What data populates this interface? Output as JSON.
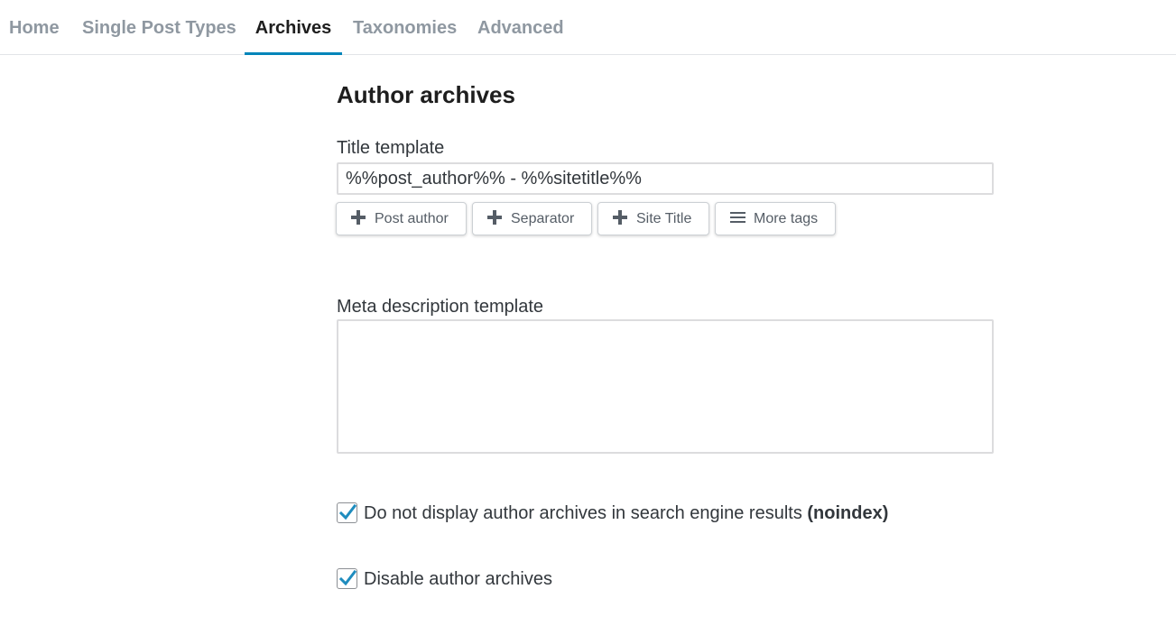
{
  "tabs": {
    "home": "Home",
    "single_post_types": "Single Post Types",
    "archives": "Archives",
    "taxonomies": "Taxonomies",
    "advanced": "Advanced",
    "active": "archives"
  },
  "section": {
    "title": "Author archives"
  },
  "title_template": {
    "label": "Title template",
    "value": "%%post_author%% - %%sitetitle%%"
  },
  "tag_buttons": {
    "post_author": "Post author",
    "separator": "Separator",
    "site_title": "Site Title",
    "more_tags": "More tags"
  },
  "meta_description": {
    "label": "Meta description template",
    "value": ""
  },
  "noindex": {
    "label": "Do not display author archives in search engine results",
    "label_bold": "(noindex)",
    "checked": true
  },
  "disable_archives": {
    "label": "Disable author archives",
    "checked": true
  },
  "colors": {
    "accent": "#0085ba",
    "checkmark": "#1e8cbe",
    "active_tab_text": "#1e1e1e",
    "inactive_tab_text": "#8f98a1"
  }
}
